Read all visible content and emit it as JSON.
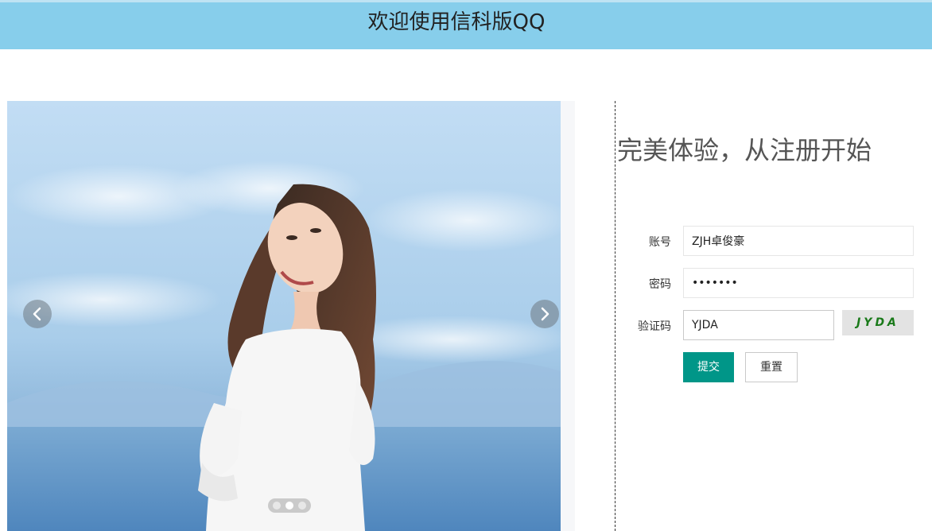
{
  "header": {
    "title": "欢迎使用信科版QQ",
    "background": "#87ceeb"
  },
  "carousel": {
    "image_alt": "girl-by-the-sea-photo",
    "prev_icon": "chevron-left-icon",
    "next_icon": "chevron-right-icon",
    "slides_count": 3,
    "active_slide": 2
  },
  "register": {
    "heading": "完美体验，从注册开始",
    "account_label": "账号",
    "account_value": "ZJH卓俊豪",
    "password_label": "密码",
    "password_value": "•••••••",
    "captcha_label": "验证码",
    "captcha_value": "YJDA",
    "captcha_code": "JYDA",
    "submit_label": "提交",
    "reset_label": "重置",
    "accent_color": "#009688"
  }
}
